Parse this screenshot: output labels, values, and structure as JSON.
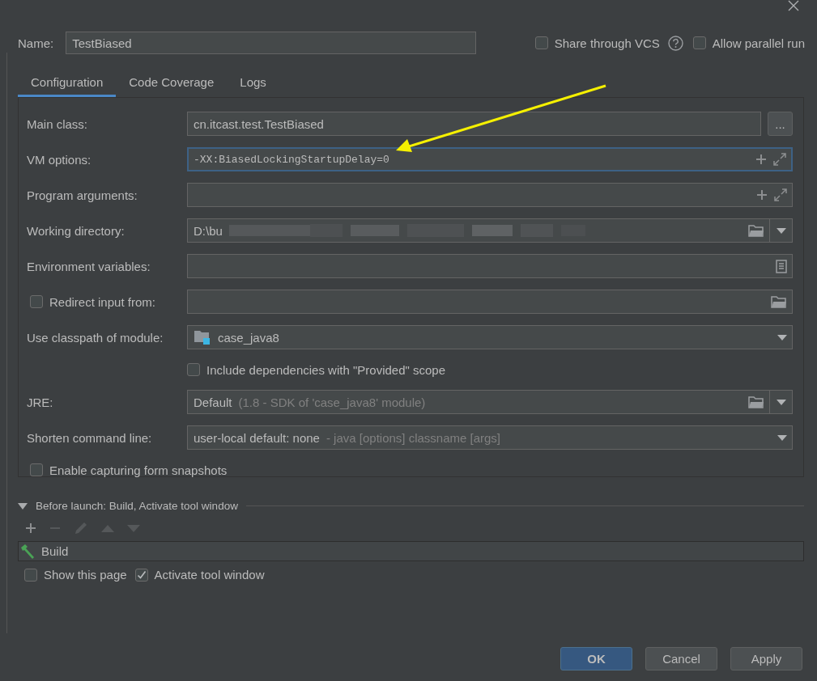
{
  "name_field": {
    "label": "Name:",
    "value": "TestBiased"
  },
  "header_options": [
    {
      "label": "Share through VCS",
      "checked": false,
      "help": true
    },
    {
      "label": "Allow parallel run",
      "checked": false,
      "help": false
    }
  ],
  "tabs": [
    {
      "label": "Configuration",
      "selected": true
    },
    {
      "label": "Code Coverage",
      "selected": false
    },
    {
      "label": "Logs",
      "selected": false
    }
  ],
  "fields": [
    {
      "kind": "browse",
      "label": "Main class:",
      "value": "cn.itcast.test.TestBiased",
      "button": "...",
      "focused": false
    },
    {
      "kind": "expandable",
      "label": "VM options:",
      "value": "-XX:BiasedLockingStartupDelay=0",
      "focused": true
    },
    {
      "kind": "expandable",
      "label": "Program arguments:",
      "focused": false
    },
    {
      "kind": "path_dropdown",
      "label": "Working directory:",
      "value": "D:\\bu",
      "redacted": true,
      "focused": false
    },
    {
      "kind": "env",
      "label": "Environment variables:",
      "focused": false
    },
    {
      "kind": "checked_path",
      "label": "Redirect input from:",
      "checked": false,
      "focused": false
    },
    {
      "kind": "module",
      "label": "Use classpath of module:",
      "value": "case_java8",
      "focused": false
    },
    {
      "kind": "checkbox",
      "label": "Include dependencies with \"Provided\" scope",
      "checked": false
    },
    {
      "kind": "path_dropdown",
      "label": "JRE:",
      "value": "Default",
      "hint": "(1.8 - SDK of 'case_java8' module)",
      "focused": false
    },
    {
      "kind": "dropdown",
      "label": "Shorten command line:",
      "value": "user-local default: none",
      "hint": "- java [options] classname [args]",
      "focused": false
    },
    {
      "kind": "checkbox_wide",
      "label": "Enable capturing form snapshots",
      "checked": false
    }
  ],
  "before_launch": {
    "title": "Before launch: Build, Activate tool window",
    "expanded": true,
    "tasks": [
      {
        "label": "Build"
      }
    ],
    "options": [
      {
        "label": "Show this page",
        "checked": false
      },
      {
        "label": "Activate tool window",
        "checked": true
      }
    ]
  },
  "buttons": [
    {
      "label": "OK",
      "default": true
    },
    {
      "label": "Cancel",
      "default": false
    },
    {
      "label": "Apply",
      "default": false
    }
  ]
}
